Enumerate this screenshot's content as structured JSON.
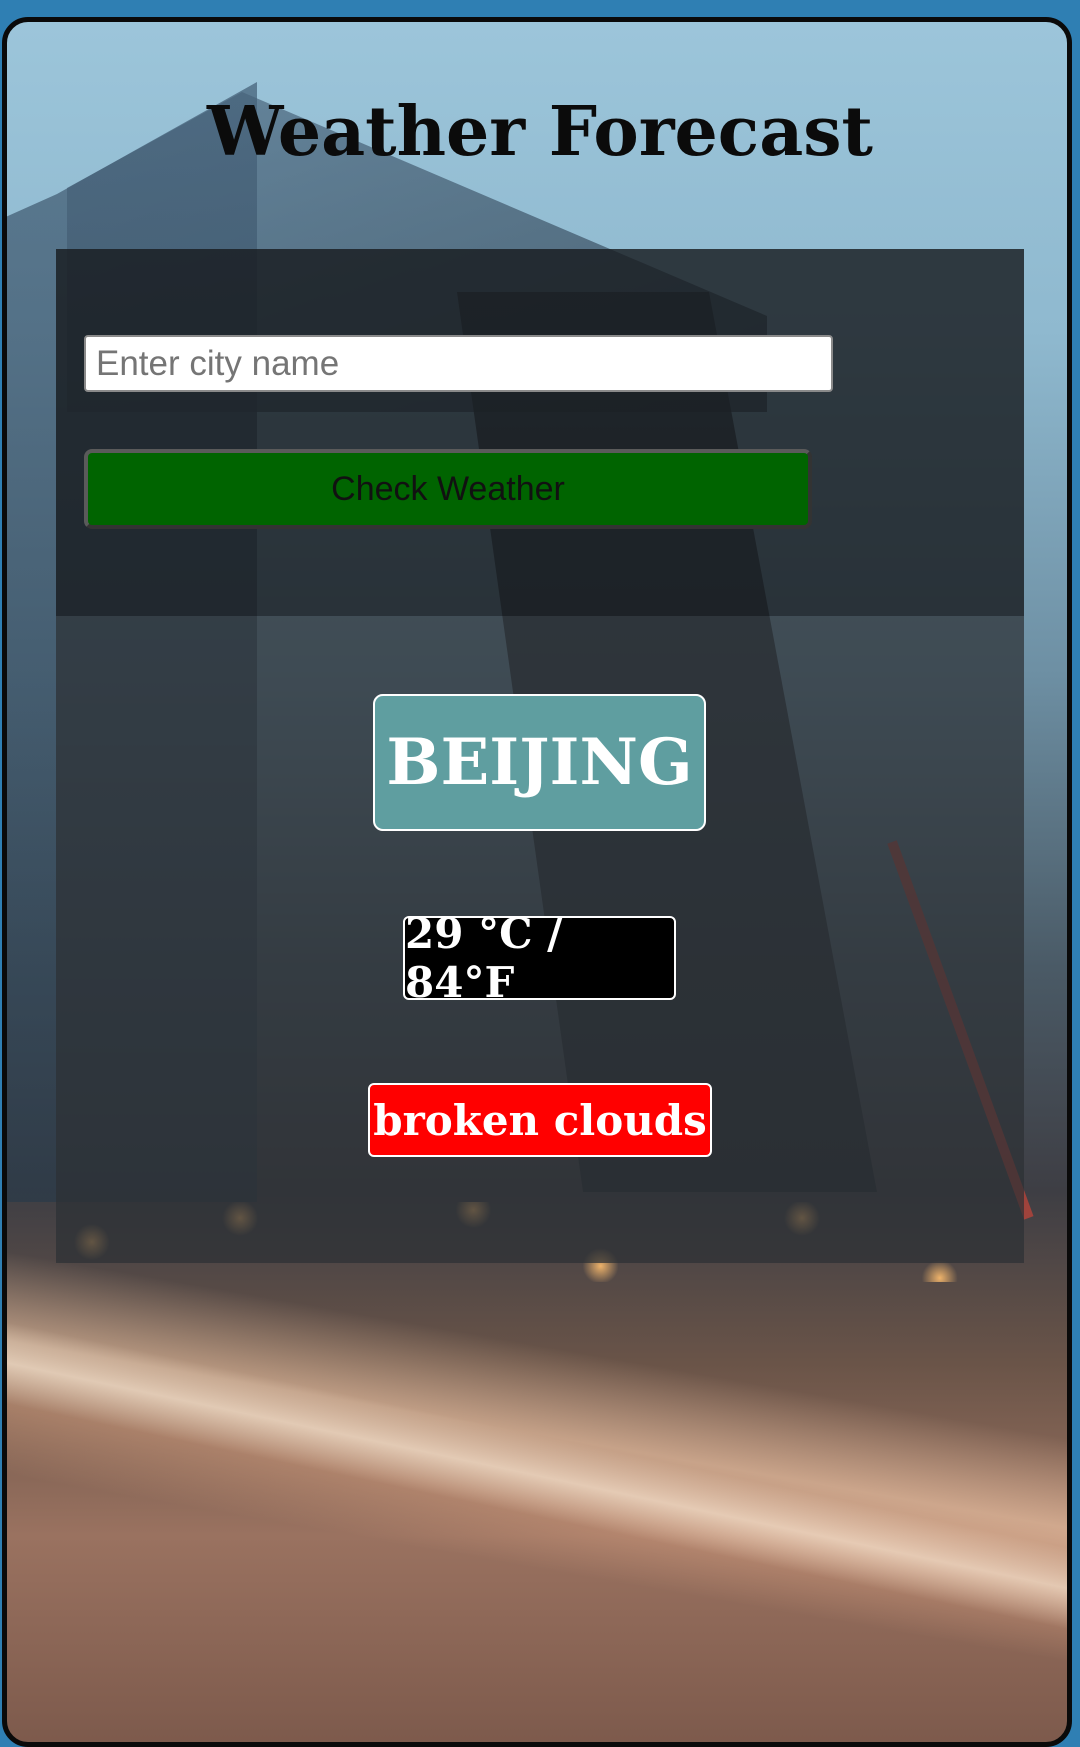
{
  "app": {
    "title": "Weather Forecast"
  },
  "search": {
    "placeholder": "Enter city name",
    "value": "",
    "button_label": "Check Weather"
  },
  "result": {
    "city": "BEIJING",
    "temperature": "29 °C / 84°F",
    "description": "broken clouds"
  },
  "colors": {
    "button": "#006400",
    "city_badge": "#5f9ea0",
    "temperature_badge": "#000000",
    "description_badge": "#ff0000"
  }
}
